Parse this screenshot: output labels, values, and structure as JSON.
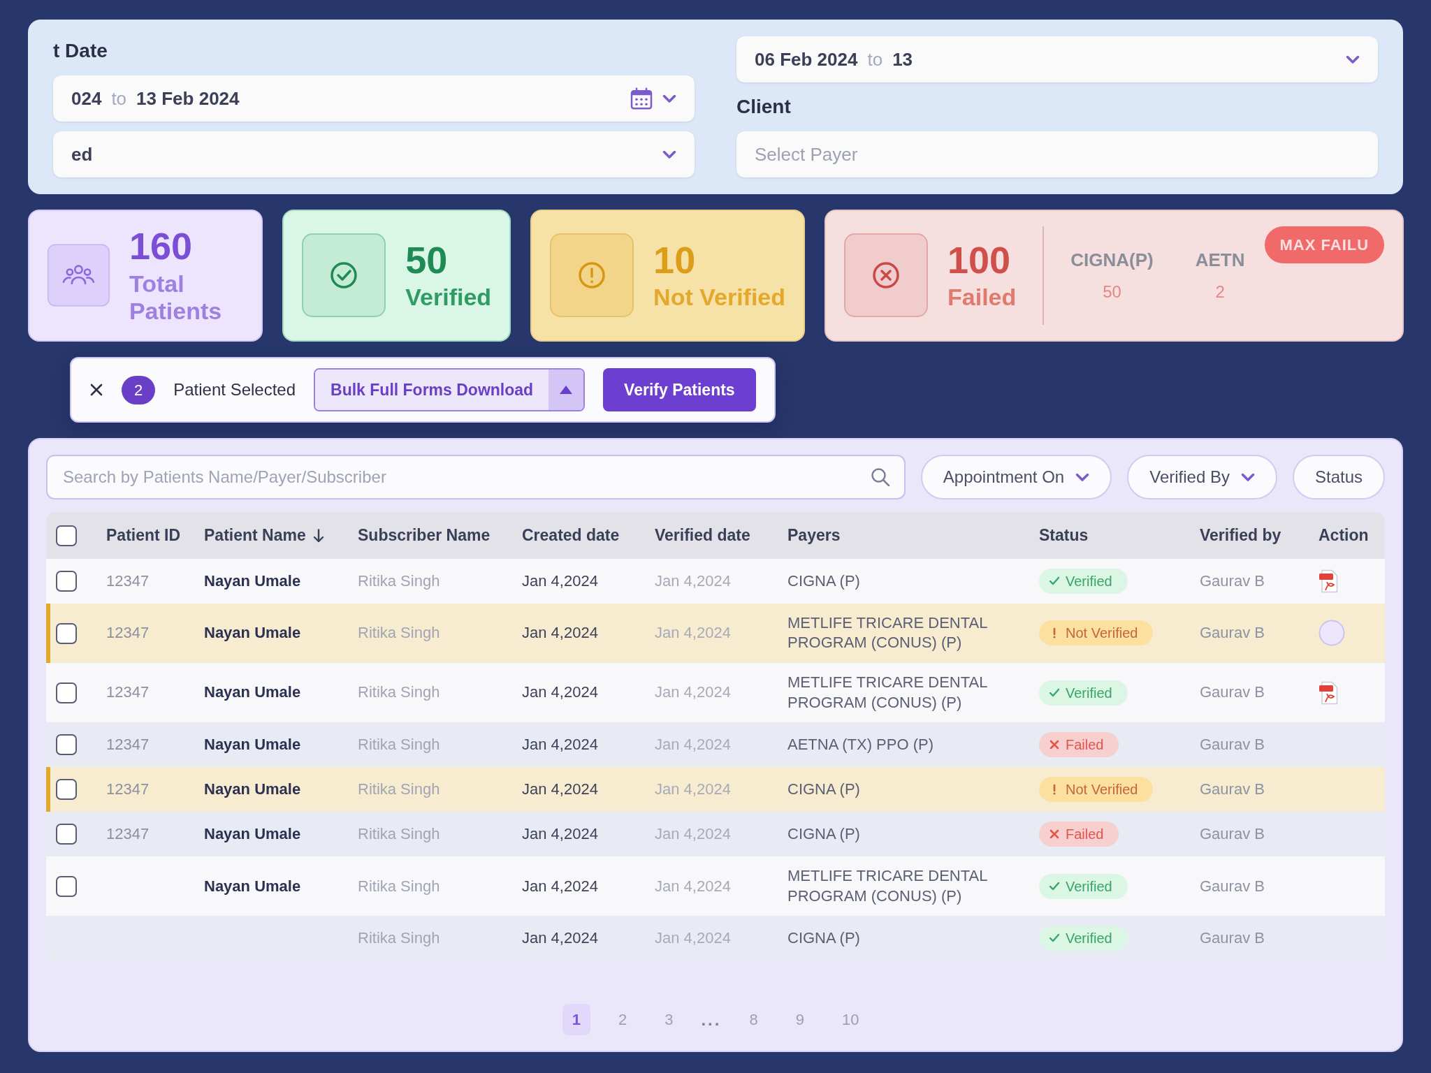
{
  "filters": {
    "columns": [
      [
        {
          "kind": "label",
          "text": "t Date"
        },
        {
          "kind": "date_range",
          "start": "024",
          "joiner": "to",
          "end": "13 Feb 2024",
          "calendar": true,
          "caret": true
        },
        {
          "kind": "select",
          "value": "ed",
          "caret": true
        }
      ],
      [
        {
          "kind": "date_range",
          "start": "06 Feb 2024",
          "joiner": "to",
          "end": "13",
          "calendar": false,
          "caret": true
        },
        {
          "kind": "label",
          "text": "Client"
        },
        {
          "kind": "select",
          "placeholder": "Select Payer",
          "caret": false
        }
      ]
    ]
  },
  "stats": [
    {
      "kind": "total",
      "value": "160",
      "label": "Total Patients"
    },
    {
      "kind": "verified",
      "value": "50",
      "label": "Verified"
    },
    {
      "kind": "not_verified",
      "value": "10",
      "label": "Not Verified"
    },
    {
      "kind": "failed",
      "value": "100",
      "label": "Failed",
      "breakdown": [
        {
          "payer": "CIGNA(P)",
          "count": "50"
        },
        {
          "payer": "AETN",
          "count": "2"
        }
      ],
      "badge": "MAX FAILU"
    }
  ],
  "selection_bar": {
    "count": "2",
    "label": "Patient Selected",
    "menu_button": "Bulk Full Forms Download",
    "primary_button": "Verify Patients"
  },
  "search": {
    "placeholder": "Search by Patients Name/Payer/Subscriber"
  },
  "filter_pills": [
    {
      "label": "Appointment On",
      "caret": true
    },
    {
      "label": "Verified By",
      "caret": true
    },
    {
      "label": "Status",
      "caret": false
    }
  ],
  "table": {
    "header_checkbox": {
      "checked": false
    },
    "columns": [
      {
        "label": "Patient ID",
        "sorted": false
      },
      {
        "label": "Patient Name",
        "sorted": true
      },
      {
        "label": "Subscriber Name",
        "sorted": false
      },
      {
        "label": "Created date",
        "sorted": false
      },
      {
        "label": "Verified date",
        "sorted": false
      },
      {
        "label": "Payers",
        "sorted": false
      },
      {
        "label": "Status",
        "sorted": false
      },
      {
        "label": "Verified by",
        "sorted": false
      },
      {
        "label": "Action",
        "sorted": false
      }
    ],
    "rows": [
      {
        "selected": false,
        "checked": false,
        "patient_id": "12347",
        "patient_name": "Nayan Umale",
        "subscriber": "Ritika Singh",
        "created": "Jan 4,2024",
        "verified": "Jan 4,2024",
        "payer": "CIGNA (P)",
        "status": {
          "kind": "verified",
          "label": "Verified"
        },
        "verified_by": "Gaurav B",
        "action": {
          "kind": "pdf"
        }
      },
      {
        "selected": true,
        "checked": false,
        "patient_id": "12347",
        "patient_name": "Nayan Umale",
        "subscriber": "Ritika Singh",
        "created": "Jan 4,2024",
        "verified": "Jan 4,2024",
        "payer": "METLIFE TRICARE DENTAL PROGRAM (CONUS) (P)",
        "status": {
          "kind": "not_verified",
          "label": "Not Verified"
        },
        "verified_by": "Gaurav B",
        "action": {
          "kind": "round"
        }
      },
      {
        "selected": false,
        "checked": false,
        "patient_id": "12347",
        "patient_name": "Nayan Umale",
        "subscriber": "Ritika Singh",
        "created": "Jan 4,2024",
        "verified": "Jan 4,2024",
        "payer": "METLIFE TRICARE DENTAL PROGRAM (CONUS) (P)",
        "status": {
          "kind": "verified",
          "label": "Verified"
        },
        "verified_by": "Gaurav B",
        "action": {
          "kind": "pdf"
        }
      },
      {
        "selected": false,
        "checked": false,
        "patient_id": "12347",
        "patient_name": "Nayan Umale",
        "subscriber": "Ritika Singh",
        "created": "Jan 4,2024",
        "verified": "Jan 4,2024",
        "payer": "AETNA (TX) PPO (P)",
        "status": {
          "kind": "failed",
          "label": "Failed"
        },
        "verified_by": "Gaurav B"
      },
      {
        "selected": true,
        "checked": false,
        "patient_id": "12347",
        "patient_name": "Nayan Umale",
        "subscriber": "Ritika Singh",
        "created": "Jan 4,2024",
        "verified": "Jan 4,2024",
        "payer": "CIGNA (P)",
        "status": {
          "kind": "not_verified",
          "label": "Not Verified"
        },
        "verified_by": "Gaurav B"
      },
      {
        "selected": false,
        "checked": false,
        "patient_id": "12347",
        "patient_name": "Nayan Umale",
        "subscriber": "Ritika Singh",
        "created": "Jan 4,2024",
        "verified": "Jan 4,2024",
        "payer": "CIGNA (P)",
        "status": {
          "kind": "failed",
          "label": "Failed"
        },
        "verified_by": "Gaurav B"
      },
      {
        "selected": false,
        "checked": false,
        "patient_name": "Nayan Umale",
        "subscriber": "Ritika Singh",
        "created": "Jan 4,2024",
        "verified": "Jan 4,2024",
        "payer": "METLIFE TRICARE DENTAL PROGRAM (CONUS) (P)",
        "status": {
          "kind": "verified",
          "label": "Verified"
        },
        "verified_by": "Gaurav B"
      },
      {
        "selected": false,
        "subscriber": "Ritika Singh",
        "created": "Jan 4,2024",
        "verified": "Jan 4,2024",
        "payer": "CIGNA (P)",
        "status": {
          "kind": "verified",
          "label": "Verified"
        },
        "verified_by": "Gaurav B"
      }
    ]
  },
  "pagination": [
    {
      "kind": "page",
      "label": "1",
      "selected": true
    },
    {
      "kind": "page",
      "label": "2",
      "selected": false
    },
    {
      "kind": "page",
      "label": "3",
      "selected": false
    },
    {
      "kind": "gap",
      "label": "...",
      "selected": false
    },
    {
      "kind": "page",
      "label": "8",
      "selected": false
    },
    {
      "kind": "page",
      "label": "9",
      "selected": false
    },
    {
      "kind": "page",
      "label": "10",
      "selected": false
    }
  ]
}
